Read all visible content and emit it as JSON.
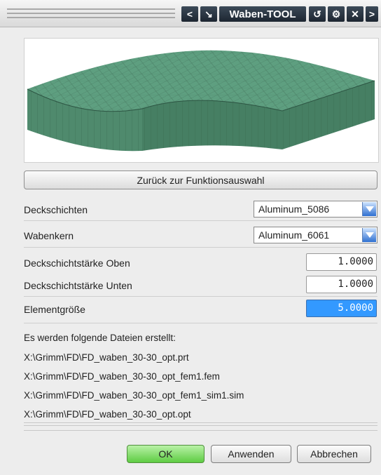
{
  "window": {
    "title": "Waben-TOOL",
    "buttons": {
      "prev": "<",
      "select": "↘",
      "undo": "↺",
      "settings": "⚙",
      "close": "✕",
      "next": ">"
    }
  },
  "back_button": "Zurück zur Funktionsauswahl",
  "fields": {
    "deckschichten": {
      "label": "Deckschichten",
      "value": "Aluminum_5086"
    },
    "wabenkern": {
      "label": "Wabenkern",
      "value": "Aluminum_6061"
    },
    "staerke_oben": {
      "label": "Deckschichtstärke Oben",
      "value": "1.0000"
    },
    "staerke_unten": {
      "label": "Deckschichtstärke Unten",
      "value": "1.0000"
    },
    "elementgroesse": {
      "label": "Elementgröße",
      "value": "5.0000"
    }
  },
  "info": {
    "heading": "Es werden folgende Dateien erstellt:",
    "files": [
      "X:\\Grimm\\FD\\FD_waben_30-30_opt.prt",
      "X:\\Grimm\\FD\\FD_waben_30-30_opt_fem1.fem",
      "X:\\Grimm\\FD\\FD_waben_30-30_opt_fem1_sim1.sim",
      "X:\\Grimm\\FD\\FD_waben_30-30_opt.opt"
    ]
  },
  "footer": {
    "ok": "OK",
    "apply": "Anwenden",
    "cancel": "Abbrechen"
  },
  "colors": {
    "accent": "#3399ff",
    "ok_green": "#5ecc43",
    "mesh_top": "#5c9c7d",
    "mesh_side": "#437a61"
  }
}
